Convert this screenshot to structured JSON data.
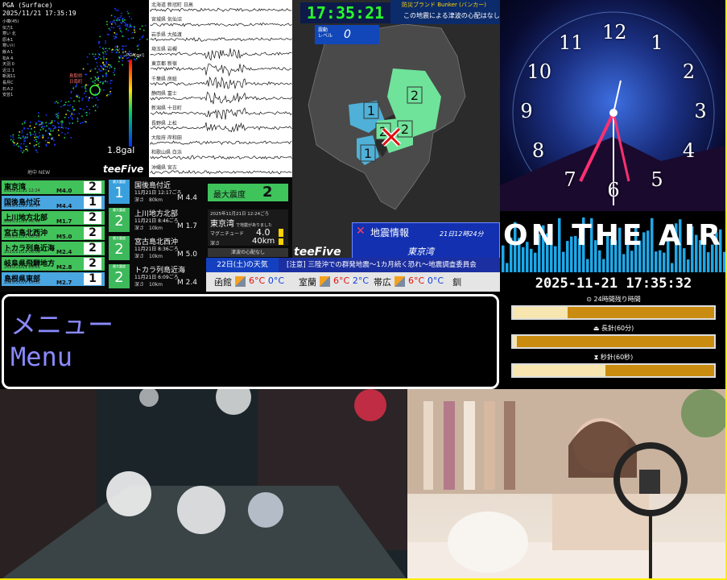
{
  "pga": {
    "header": "PGA (Surface)",
    "timestamp": "2025/11/21 17:35:19",
    "legend": [
      "小樽(45)",
      "伝力1",
      "寒い 北",
      "原木1",
      "寒い川",
      "飯Ａ1",
      "松A 4",
      "天羽 0",
      "近江 1",
      "新潟11",
      "長月C",
      "石Ａ2",
      "安芸1"
    ],
    "scale_title": "PGA[gal]",
    "gal_readout": "1.8gal",
    "logo": "teeFive",
    "new_tag": "地中 NEW",
    "annotation": "鳥取県\n日南町"
  },
  "seismo": {
    "labels": [
      "北海道 新冠町 日高",
      "宮城県 気仙沼",
      "岩手県 大船渡",
      "埼玉県 岩槻",
      "東京都 新宿",
      "千葉県 房総",
      "静岡県 富士",
      "新潟県 十日町",
      "長野県 上松",
      "大阪府 岸和田",
      "和歌山県 白浜",
      "沖縄県 宮古"
    ]
  },
  "central": {
    "digital_clock": "17:35:21",
    "shindo_label": "震動\nレベル",
    "shindo_value": "0",
    "tsunami_title": "防災ブランド Bunker (バンカー)",
    "tsunami_text": "この地震による津波の心配はなし",
    "eq_info_title": "地震情報",
    "eq_info_date": "21日12時24分",
    "eq_info_place": "東京湾",
    "logo": "teeFive",
    "intensities": [
      "2",
      "1",
      "2",
      "2",
      "1"
    ]
  },
  "quakes": [
    {
      "place": "東京湾",
      "date": "2025/11/21 12:24",
      "mag": "M4.0",
      "shindo": "2",
      "color": "#42c25a"
    },
    {
      "place": "国後島付近",
      "date": "2025/11/21 12:17",
      "mag": "M4.4",
      "shindo": "1",
      "color": "#4aa6e0"
    },
    {
      "place": "上川地方北部",
      "date": "2025/11/21 08:46",
      "mag": "M1.7",
      "shindo": "2",
      "color": "#42c25a"
    },
    {
      "place": "宮古島北西沖",
      "date": "2025/11/21 08:36",
      "mag": "M5.0",
      "shindo": "2",
      "color": "#42c25a"
    },
    {
      "place": "トカラ列島近海",
      "date": "2025/11/21 06:09",
      "mag": "M2.4",
      "shindo": "2",
      "color": "#42c25a"
    },
    {
      "place": "岐阜県飛騨地方",
      "date": "2025/11/21 03:51",
      "mag": "M2.8",
      "shindo": "2",
      "color": "#42c25a"
    },
    {
      "place": "島根県東部",
      "date": "2025/11/20 10:35",
      "mag": "M2.7",
      "shindo": "1",
      "color": "#4aa6e0"
    }
  ],
  "details": [
    {
      "place": "国後島付近",
      "date": "11月21日 12:17ごろ",
      "depth": "深さ　80km",
      "mag": "M 4.4",
      "shindo": "1",
      "scale": "最大震度",
      "color": "#3aa0dd"
    },
    {
      "place": "上川地方北部",
      "date": "11月21日 8:46ごろ",
      "depth": "深さ　10km",
      "mag": "M 1.7",
      "shindo": "2",
      "scale": "最大震度",
      "color": "#3db85a"
    },
    {
      "place": "宮古島北西沖",
      "date": "11月21日 8:36ごろ",
      "depth": "深さ　10km",
      "mag": "M 5.0",
      "shindo": "2",
      "scale": "最大震度",
      "color": "#3db85a"
    },
    {
      "place": "トカラ列島近海",
      "date": "11月21日 6:09ごろ",
      "depth": "深さ　10km",
      "mag": "M 2.4",
      "shindo": "2",
      "scale": "最大震度",
      "color": "#3db85a"
    }
  ],
  "maxpanel": {
    "label": "最大震度",
    "value": "2",
    "date": "2025年11月21日 12:24ごろ",
    "place": "東京湾",
    "place_note": "で地震がありました",
    "mag_label": "マグニチュード",
    "mag_value": "4.0",
    "depth_label": "深さ",
    "depth_value": "40km",
    "tsunami": "津波の心配なし"
  },
  "weather": {
    "title": "22日(土)の天気",
    "ticker": "[注意] 三陸沖での群発地震〜1カ月続く恐れ〜地震調査委員会",
    "cities": [
      {
        "name": "函館",
        "hi": "6°C",
        "lo": "0°C"
      },
      {
        "name": "室蘭",
        "hi": "6°C",
        "lo": "2°C"
      },
      {
        "name": "帯広",
        "hi": "6°C",
        "lo": "0°C"
      },
      {
        "name": "釧",
        "hi": "",
        "lo": ""
      }
    ]
  },
  "clock": {
    "numbers": [
      "12",
      "1",
      "2",
      "3",
      "4",
      "5",
      "6",
      "7",
      "8",
      "9",
      "10",
      "11"
    ]
  },
  "onair": {
    "text": "ON THE AIR"
  },
  "dt_panel": {
    "datetime": "2025-11-21 17:35:32",
    "bars": [
      {
        "label": "⊙ 24時間残り時間",
        "fraction": 0.27
      },
      {
        "label": "⏏ 長針(60分)",
        "fraction": 0.02
      },
      {
        "label": "⧗ 秒針(60秒)",
        "fraction": 0.46
      }
    ]
  },
  "menu": {
    "line1": "メニュー",
    "line2": "Menu"
  }
}
